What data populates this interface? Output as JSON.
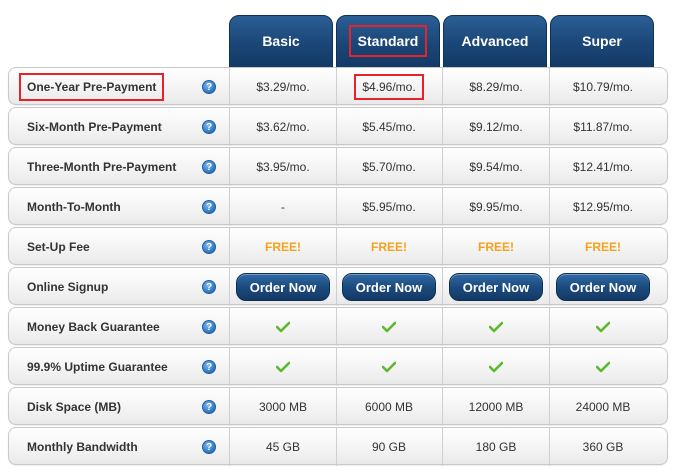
{
  "plans": [
    "Basic",
    "Standard",
    "Advanced",
    "Super"
  ],
  "rows": [
    {
      "label": "One-Year Pre-Payment",
      "help": "?",
      "values": [
        "$3.29/mo.",
        "$4.96/mo.",
        "$8.29/mo.",
        "$10.79/mo."
      ]
    },
    {
      "label": "Six-Month Pre-Payment",
      "help": "?",
      "values": [
        "$3.62/mo.",
        "$5.45/mo.",
        "$9.12/mo.",
        "$11.87/mo."
      ]
    },
    {
      "label": "Three-Month Pre-Payment",
      "help": "?",
      "values": [
        "$3.95/mo.",
        "$5.70/mo.",
        "$9.54/mo.",
        "$12.41/mo."
      ]
    },
    {
      "label": "Month-To-Month",
      "help": "?",
      "values": [
        "-",
        "$5.95/mo.",
        "$9.95/mo.",
        "$12.95/mo."
      ]
    },
    {
      "label": "Set-Up Fee",
      "help": "?",
      "values": [
        "FREE!",
        "FREE!",
        "FREE!",
        "FREE!"
      ]
    },
    {
      "label": "Online Signup",
      "help": "?",
      "values": [
        "Order Now",
        "Order Now",
        "Order Now",
        "Order Now"
      ]
    },
    {
      "label": "Money Back Guarantee",
      "help": "?",
      "values": [
        "check-icon",
        "check-icon",
        "check-icon",
        "check-icon"
      ]
    },
    {
      "label": "99.9% Uptime Guarantee",
      "help": "?",
      "values": [
        "check-icon",
        "check-icon",
        "check-icon",
        "check-icon"
      ]
    },
    {
      "label": "Disk Space (MB)",
      "help": "?",
      "values": [
        "3000 MB",
        "6000 MB",
        "12000 MB",
        "24000 MB"
      ]
    },
    {
      "label": "Monthly Bandwidth",
      "help": "?",
      "values": [
        "45 GB",
        "90 GB",
        "180 GB",
        "360 GB"
      ]
    }
  ],
  "colors": {
    "header_blue": "#1a4677",
    "free_orange": "#f4a21c",
    "check_green": "#5cb82e",
    "highlight_red": "#e8222a"
  }
}
